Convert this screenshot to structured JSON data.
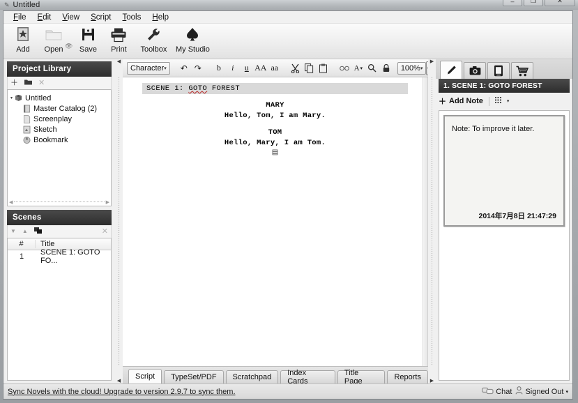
{
  "window": {
    "title": "Untitled",
    "title_icon": "pen-icon",
    "controls": [
      {
        "name": "minimize-button",
        "glyph": "–"
      },
      {
        "name": "maximize-button",
        "glyph": "❐"
      },
      {
        "name": "close-button",
        "glyph": "✕"
      }
    ]
  },
  "menubar": {
    "items": [
      {
        "label": "File",
        "accel": "F"
      },
      {
        "label": "Edit",
        "accel": "E"
      },
      {
        "label": "View",
        "accel": "V"
      },
      {
        "label": "Script",
        "accel": "S"
      },
      {
        "label": "Tools",
        "accel": "T"
      },
      {
        "label": "Help",
        "accel": "H"
      }
    ]
  },
  "main_toolbar": {
    "buttons": [
      {
        "label": "Add",
        "icon": "star-in-box-icon"
      },
      {
        "label": "Open",
        "icon": "folder-icon"
      },
      {
        "label": "Save",
        "icon": "floppy-disk-icon"
      },
      {
        "label": "Print",
        "icon": "printer-icon"
      },
      {
        "label": "Toolbox",
        "icon": "wrench-icon"
      },
      {
        "label": "My Studio",
        "icon": "spade-tree-icon"
      }
    ],
    "eye_icon": "eye-icon"
  },
  "left_panel": {
    "library": {
      "title": "Project Library",
      "tools": [
        {
          "name": "add-item-button",
          "glyph": "＋"
        },
        {
          "name": "new-folder-button",
          "glyph": "▬"
        },
        {
          "name": "remove-item-button",
          "glyph": "✕"
        }
      ],
      "tree": {
        "root": {
          "label": "Untitled",
          "icon": "book-icon",
          "expander": "▾"
        },
        "children": [
          {
            "label": "Master Catalog (2)",
            "icon": "catalog-icon"
          },
          {
            "label": "Screenplay",
            "icon": "page-icon"
          },
          {
            "label": "Sketch",
            "icon": "sketch-icon"
          },
          {
            "label": "Bookmark",
            "icon": "bookmark-icon"
          }
        ]
      }
    },
    "scenes": {
      "title": "Scenes",
      "tools": [
        {
          "name": "move-down-button",
          "glyph": "▼"
        },
        {
          "name": "move-up-button",
          "glyph": "▲"
        },
        {
          "name": "cards-button",
          "glyph": "◰"
        },
        {
          "name": "delete-scene-button",
          "glyph": "✕"
        }
      ],
      "columns": [
        "#",
        "Title"
      ],
      "rows": [
        {
          "num": "1",
          "title": "SCENE 1: GOTO FO..."
        }
      ]
    }
  },
  "format_toolbar": {
    "element_select": {
      "value": "Character",
      "arrow": "▾"
    },
    "buttons": [
      {
        "name": "undo-button",
        "glyph": "↶"
      },
      {
        "name": "redo-button",
        "glyph": "↷"
      },
      {
        "name": "bold-button",
        "glyph": "b"
      },
      {
        "name": "italic-button",
        "glyph": "i"
      },
      {
        "name": "underline-button",
        "glyph": "u"
      },
      {
        "name": "uppercase-button",
        "glyph": "AA"
      },
      {
        "name": "lowercase-button",
        "glyph": "aa"
      },
      {
        "name": "cut-button",
        "glyph": "✂"
      },
      {
        "name": "copy-button",
        "glyph": "⧉"
      },
      {
        "name": "paste-button",
        "glyph": "Ὄb"
      },
      {
        "name": "spellcheck-button",
        "glyph": "◌"
      },
      {
        "name": "text-style-button",
        "glyph": "A▾"
      },
      {
        "name": "find-button",
        "glyph": "⚲"
      },
      {
        "name": "lock-button",
        "glyph": "ὑ2"
      }
    ],
    "zoom_select": {
      "value": "100%",
      "arrow": "▾"
    },
    "panel_toggle": {
      "name": "toggle-right-panel-button",
      "glyph": "▸▐"
    }
  },
  "script": {
    "scene_heading": {
      "prefix": "SCENE 1: ",
      "misspelled": "GOTO",
      "suffix": " FOREST"
    },
    "blocks": [
      {
        "character": "MARY",
        "dialogue": "Hello, Tom, I am Mary."
      },
      {
        "character": "TOM",
        "dialogue": "Hello, Mary, I am Tom."
      }
    ],
    "cursor_glyph": "▤"
  },
  "bottom_tabs": {
    "items": [
      {
        "label": "Script",
        "active": true
      },
      {
        "label": "TypeSet/PDF",
        "active": false
      },
      {
        "label": "Scratchpad",
        "active": false
      },
      {
        "label": "Index Cards",
        "active": false
      },
      {
        "label": "Title Page",
        "active": false
      },
      {
        "label": "Reports",
        "active": false
      }
    ]
  },
  "right_panel": {
    "tabs": [
      {
        "name": "notes-tab",
        "icon": "pencil-icon",
        "glyph": "✒",
        "active": true
      },
      {
        "name": "photos-tab",
        "icon": "camera-icon",
        "glyph": "■",
        "active": false
      },
      {
        "name": "documents-tab",
        "icon": "document-icon",
        "glyph": "▤",
        "active": false
      },
      {
        "name": "store-tab",
        "icon": "shopping-cart-icon",
        "glyph": "⛉",
        "active": false
      }
    ],
    "header": "1. SCENE 1: GOTO FOREST",
    "add_note_label": "Add Note",
    "add_note_plus": "＋",
    "view_mode_glyph": "∷",
    "view_mode_arrow": "▾",
    "notes": [
      {
        "text": "Note: To improve it later.",
        "date": "2014年7月8日 21:47:29"
      }
    ]
  },
  "statusbar": {
    "sync_message": "Sync Novels with the cloud! Upgrade to version 2.9.7 to sync them.",
    "chat_label": "Chat",
    "chat_icon": "chat-bubbles-icon",
    "account_label": "Signed Out",
    "account_arrow": "▾",
    "account_icon": "person-icon"
  }
}
